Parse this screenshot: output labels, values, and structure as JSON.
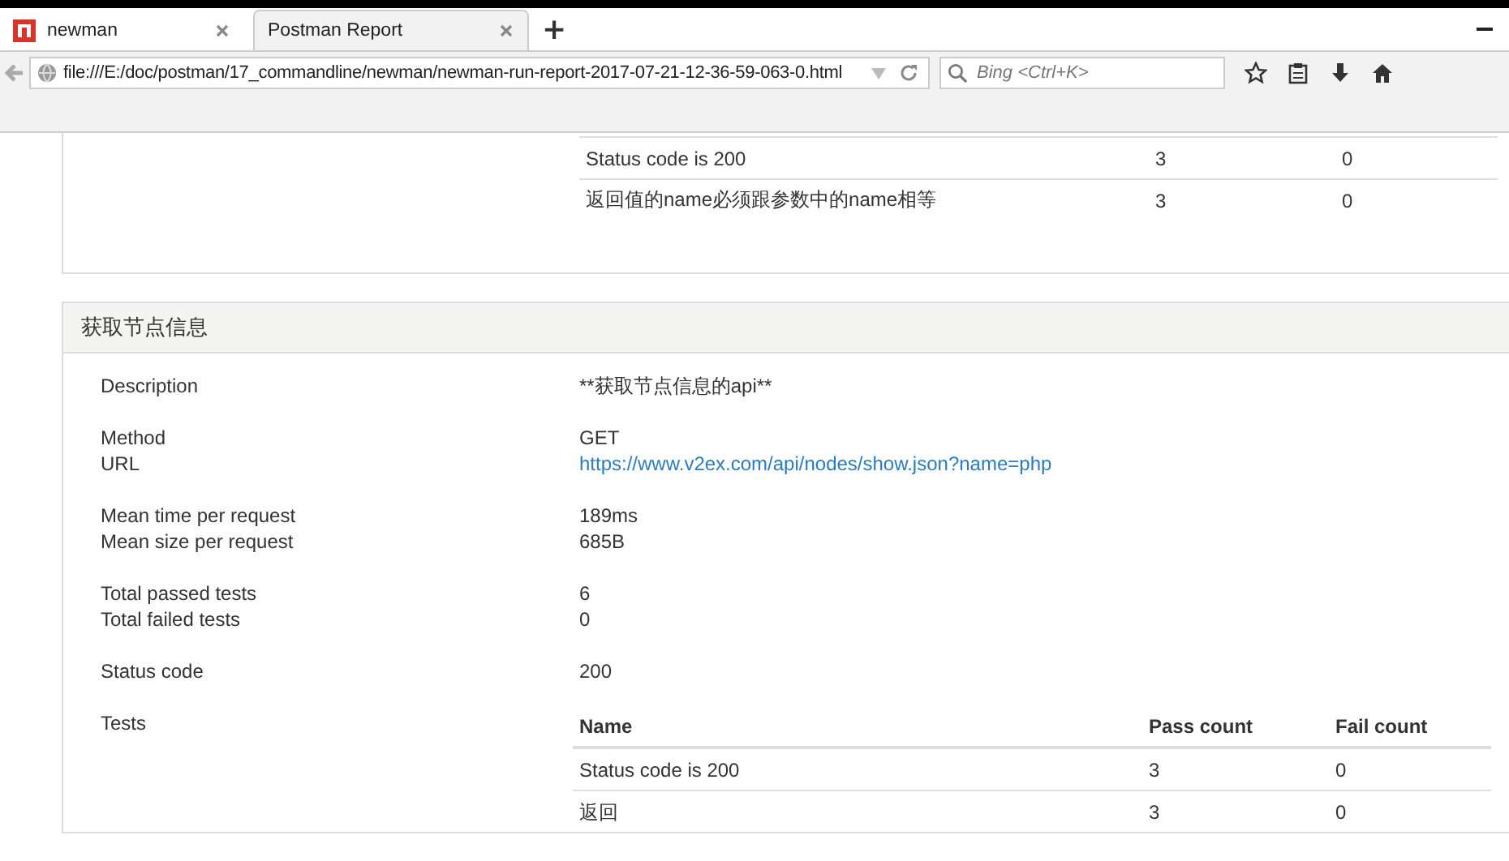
{
  "browser": {
    "tabs": [
      {
        "title": "newman",
        "selected": false,
        "kind": "app"
      },
      {
        "title": "Postman Report",
        "selected": true,
        "kind": "page"
      }
    ],
    "new_tab": "+",
    "address": "file:///E:/doc/postman/17_commandline/newman/newman-run-report-2017-07-21-12-36-59-063-0.html",
    "search": {
      "placeholder": "Bing <Ctrl+K>"
    }
  },
  "previous_tests": {
    "rows": [
      {
        "name": "Status code is 200",
        "pass": "3",
        "fail": "0"
      },
      {
        "name": "返回值的name必须跟参数中的name相等",
        "pass": "3",
        "fail": "0"
      }
    ]
  },
  "section": {
    "title": "获取节点信息",
    "groups": [
      [
        {
          "label": "Description",
          "value": "**获取节点信息的api**",
          "kind": "text"
        }
      ],
      [
        {
          "label": "Method",
          "value": "GET",
          "kind": "text"
        },
        {
          "label": "URL",
          "value": "https://www.v2ex.com/api/nodes/show.json?name=php",
          "kind": "link"
        }
      ],
      [
        {
          "label": "Mean time per request",
          "value": "189ms",
          "kind": "text"
        },
        {
          "label": "Mean size per request",
          "value": "685B",
          "kind": "text"
        }
      ],
      [
        {
          "label": "Total passed tests",
          "value": "6",
          "kind": "text"
        },
        {
          "label": "Total failed tests",
          "value": "0",
          "kind": "text"
        }
      ],
      [
        {
          "label": "Status code",
          "value": "200",
          "kind": "text"
        }
      ]
    ],
    "tests": {
      "label": "Tests",
      "columns": [
        "Name",
        "Pass count",
        "Fail count"
      ],
      "rows": [
        {
          "name": "Status code is 200",
          "pass": "3",
          "fail": "0"
        },
        {
          "name": "返回",
          "pass": "3",
          "fail": "0"
        }
      ]
    }
  }
}
